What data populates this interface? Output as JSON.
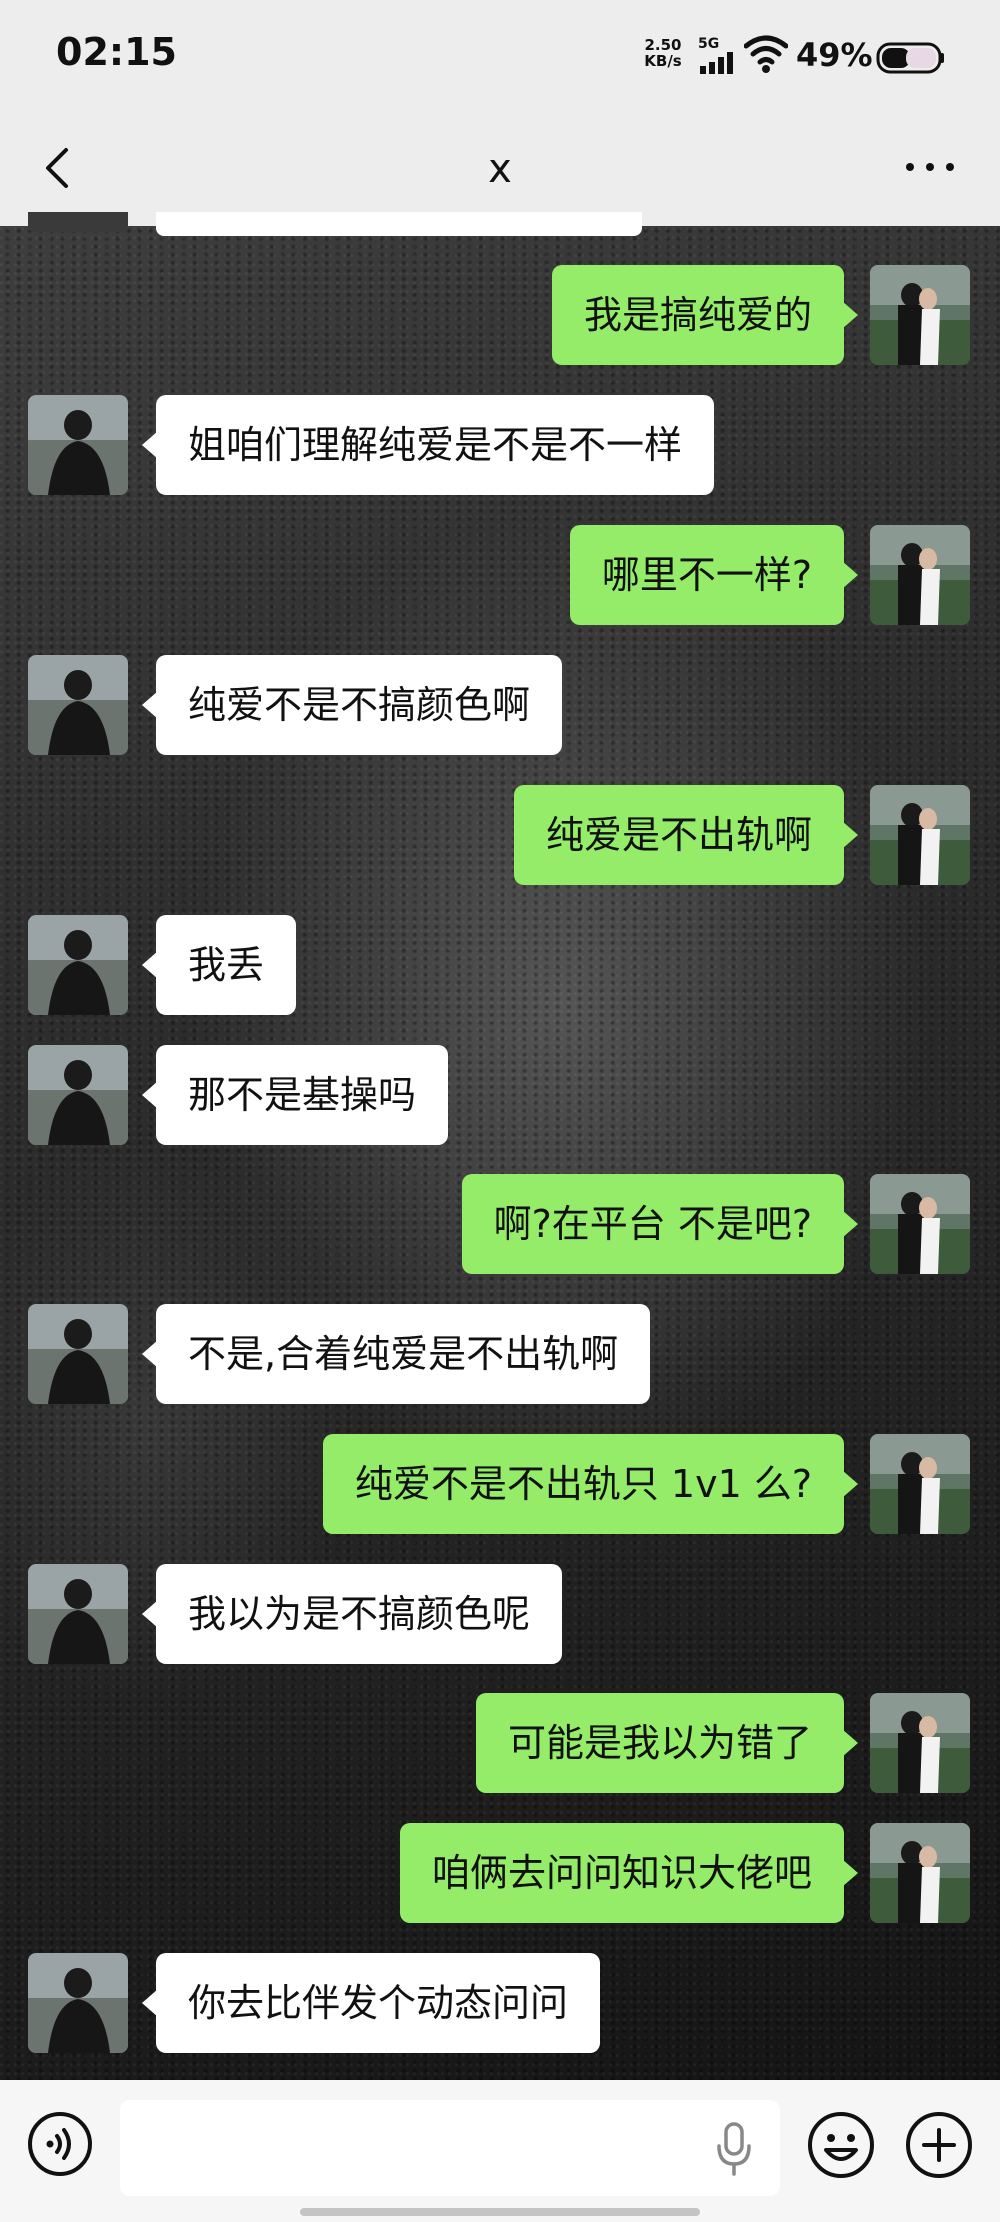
{
  "status_bar": {
    "time": "02:15",
    "net_speed_value": "2.50",
    "net_speed_unit": "KB/s",
    "network": "5G",
    "battery": "49%"
  },
  "header": {
    "title": "x",
    "back_icon": "chevron-left-icon",
    "more_icon": "more-dots-icon"
  },
  "colors": {
    "sent_bubble": "#95ec69",
    "received_bubble": "#ffffff",
    "bar_background": "#ededed"
  },
  "messages": [
    {
      "side": "right",
      "text": "我是搞纯爱的"
    },
    {
      "side": "left",
      "text": "姐咱们理解纯爱是不是不一样"
    },
    {
      "side": "right",
      "text": "哪里不一样?"
    },
    {
      "side": "left",
      "text": "纯爱不是不搞颜色啊"
    },
    {
      "side": "right",
      "text": "纯爱是不出轨啊"
    },
    {
      "side": "left",
      "text": "我丢"
    },
    {
      "side": "left",
      "text": "那不是基操吗"
    },
    {
      "side": "right",
      "text": "啊?在平台 不是吧?"
    },
    {
      "side": "left",
      "text": "不是,合着纯爱是不出轨啊"
    },
    {
      "side": "right",
      "text": "纯爱不是不出轨只 1v1 么?"
    },
    {
      "side": "left",
      "text": "我以为是不搞颜色呢"
    },
    {
      "side": "right",
      "text": "可能是我以为错了"
    },
    {
      "side": "right",
      "text": "咱俩去问问知识大佬吧"
    },
    {
      "side": "left",
      "text": "你去比伴发个动态问问"
    }
  ],
  "input_bar": {
    "value": "",
    "voice_icon": "voice-icon",
    "mic_icon": "microphone-icon",
    "emoji_icon": "emoji-icon",
    "plus_icon": "plus-icon"
  }
}
